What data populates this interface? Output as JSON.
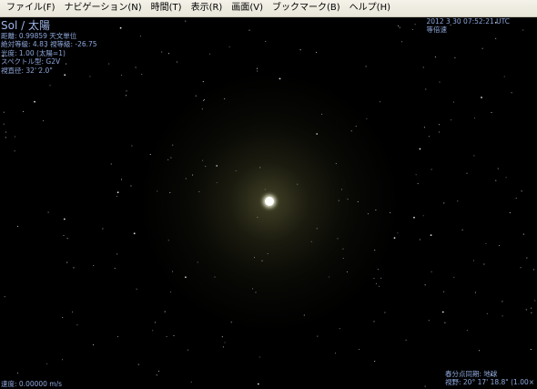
{
  "menubar": {
    "items": [
      {
        "label": "ファイル(F)"
      },
      {
        "label": "ナビゲーション(N)"
      },
      {
        "label": "時間(T)"
      },
      {
        "label": "表示(R)"
      },
      {
        "label": "画面(V)"
      },
      {
        "label": "ブックマーク(B)"
      },
      {
        "label": "ヘルプ(H)"
      }
    ]
  },
  "info": {
    "name": "Sol / 太陽",
    "distance": "距離: 0.99859 天文単位",
    "magnitude": "絶対等級: 4.83 視等級: -26.75",
    "luminosity": "光度: 1.00 (太陽=1)",
    "spectral": "スペクトル型: G2V",
    "apparent_diameter": "視直径: 32' 2.0\""
  },
  "time": {
    "datetime": "2012 3 30 07:52:21 UTC",
    "rate": "等倍速"
  },
  "speed": "速度: 0.00000 m/s",
  "frame": {
    "reference": "春分点同期: 地球",
    "fov": "視野: 20° 17' 18.8\" (1.00×"
  },
  "colors": {
    "hud_text": "#8fa8dd",
    "background": "#000000",
    "sun": "#ffffff"
  }
}
